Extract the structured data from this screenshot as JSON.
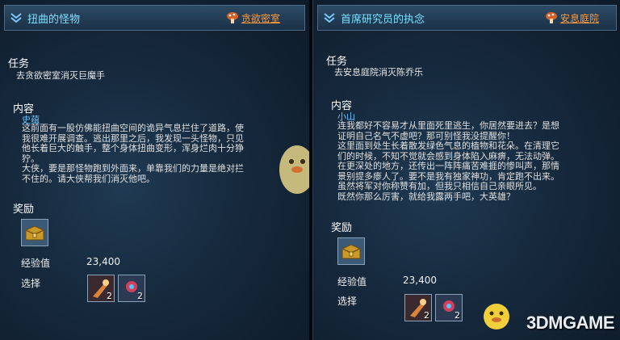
{
  "left": {
    "title": "扭曲的怪物",
    "location": "贪欲密室",
    "task_heading": "任务",
    "task_text": "去贪欲密室消灭巨魔手",
    "content_heading": "内容",
    "npc": "史蕴",
    "content_lines": [
      "这前面有一股仿佛能扭曲空间的诡异气息拦住了道路，使",
      "我很难开展调查。逃出那里之后，我发现一头怪物，只见",
      "他长着巨大的触手，整个身体扭曲变形，浑身烂肉十分狰",
      "狞。",
      "大侠，要是那怪物跑到外面来，单靠我们的力量是绝对拦",
      "不住的。请大侠帮我们消灭他吧。"
    ],
    "reward_heading": "奖励",
    "exp_label": "经验值",
    "exp_value": "23,400",
    "choose_label": "选择",
    "choice_counts": [
      "2",
      "2"
    ]
  },
  "right": {
    "title": "首席研究员的执念",
    "location": "安息庭院",
    "task_heading": "任务",
    "task_text": "去安息庭院消灭陈乔乐",
    "content_heading": "内容",
    "npc": "小山",
    "content_lines": [
      "连我都好不容易才从里面死里逃生，你居然要进去？是想",
      "证明自己名气不虚吧？那可别怪我没提醒你！",
      "这里面到处生长着散发绿色气息的植物和花朵。在清理它",
      "们的时候，不知不觉就会感到身体陷入麻痹，无法动弹。",
      "在更深处的地方，还传出一阵阵痛苦难捱的惨叫声，那情",
      "景别提多瘆人了。要不是我有独家神功，肯定跑不出来。",
      "虽然将军对你称赞有加，但我只相信自己亲眼所见。",
      "既然你那么厉害，就给我露两手吧，大英雄？"
    ],
    "reward_heading": "奖励",
    "exp_label": "经验值",
    "exp_value": "23,400",
    "choose_label": "选择",
    "choice_counts": [
      "2",
      "2"
    ]
  },
  "watermark": "3DMGAME",
  "colors": {
    "title": "#7ee0ff",
    "location": "#ff9a3c",
    "npc": "#6ec4ff"
  },
  "icons": [
    "chevron-down-icon",
    "location-mushroom-icon",
    "treasure-chest-icon",
    "claw-item-icon",
    "flower-item-icon",
    "mascot-icon"
  ]
}
